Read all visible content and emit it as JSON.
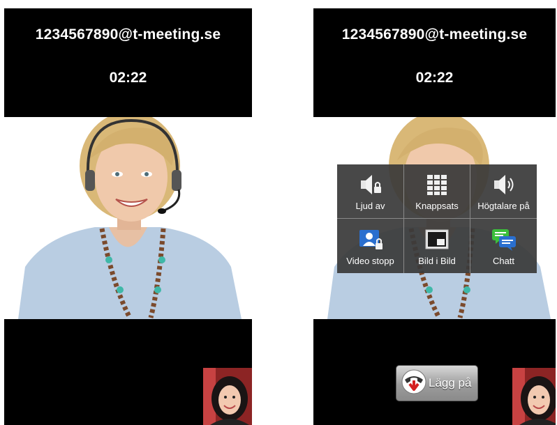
{
  "call": {
    "address": "1234567890@t-meeting.se",
    "duration": "02:22"
  },
  "quick_menu": {
    "items": [
      {
        "label": "Ljud av",
        "icon": "mute-speaker-lock-icon"
      },
      {
        "label": "Knappsats",
        "icon": "keypad-icon"
      },
      {
        "label": "Högtalare på",
        "icon": "speaker-on-icon"
      },
      {
        "label": "Video stopp",
        "icon": "video-stop-contact-icon"
      },
      {
        "label": "Bild i Bild",
        "icon": "picture-in-picture-icon"
      },
      {
        "label": "Chatt",
        "icon": "chat-bubbles-icon"
      }
    ]
  },
  "hangup": {
    "label": "Lägg på",
    "icon": "hangup-phone-icon",
    "color": "#d42020"
  },
  "colors": {
    "header_bg": "#000000",
    "menu_bg": "#3a3a3a",
    "accent_blue": "#2a6fcf",
    "chat_green": "#3bbf3b"
  }
}
